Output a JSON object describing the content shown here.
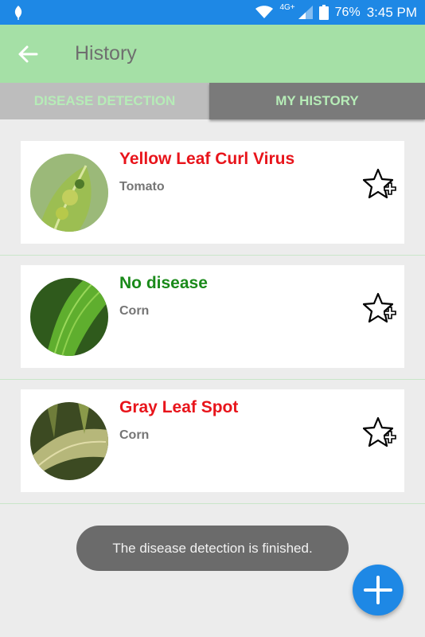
{
  "status_bar": {
    "network": "4G+",
    "battery": "76%",
    "time": "3:45 PM"
  },
  "app_bar": {
    "title": "History"
  },
  "tabs": [
    {
      "label": "DISEASE DETECTION",
      "selected": false
    },
    {
      "label": "MY HISTORY",
      "selected": true
    }
  ],
  "history": [
    {
      "disease": "Yellow Leaf Curl Virus",
      "crop": "Tomato",
      "status_color": "#e8141b"
    },
    {
      "disease": "No disease",
      "crop": "Corn",
      "status_color": "#1a8a1a"
    },
    {
      "disease": "Gray Leaf Spot",
      "crop": "Corn",
      "status_color": "#e8141b"
    }
  ],
  "toast": {
    "message": "The disease detection is finished."
  },
  "colors": {
    "status_bar": "#1e88e5",
    "app_bar": "#a5e0a6",
    "fab": "#1e88e5"
  }
}
